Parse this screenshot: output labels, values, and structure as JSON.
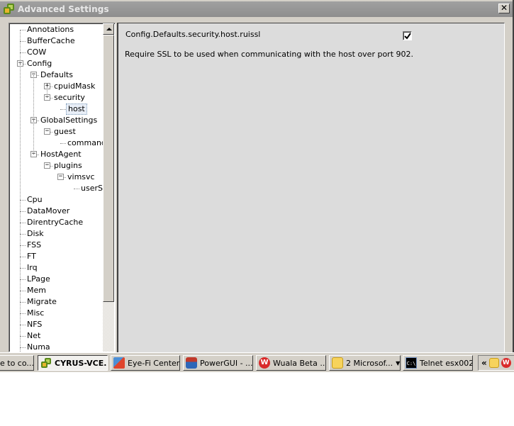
{
  "window": {
    "title": "Advanced Settings",
    "close_label": "✕"
  },
  "tree": {
    "items": [
      {
        "label": "Annotations",
        "depth": 0,
        "expander": null
      },
      {
        "label": "BufferCache",
        "depth": 0,
        "expander": null
      },
      {
        "label": "COW",
        "depth": 0,
        "expander": null
      },
      {
        "label": "Config",
        "depth": 0,
        "expander": "collapse"
      },
      {
        "label": "Defaults",
        "depth": 1,
        "expander": "collapse"
      },
      {
        "label": "cpuidMask",
        "depth": 2,
        "expander": "expand"
      },
      {
        "label": "security",
        "depth": 2,
        "expander": "collapse"
      },
      {
        "label": "host",
        "depth": 3,
        "expander": null,
        "selected": true
      },
      {
        "label": "GlobalSettings",
        "depth": 1,
        "expander": "collapse"
      },
      {
        "label": "guest",
        "depth": 2,
        "expander": "collapse"
      },
      {
        "label": "commands",
        "depth": 3,
        "expander": null
      },
      {
        "label": "HostAgent",
        "depth": 1,
        "expander": "collapse"
      },
      {
        "label": "plugins",
        "depth": 2,
        "expander": "collapse"
      },
      {
        "label": "vimsvc",
        "depth": 3,
        "expander": "collapse"
      },
      {
        "label": "userSe",
        "depth": 4,
        "expander": null
      },
      {
        "label": "Cpu",
        "depth": 0,
        "expander": null
      },
      {
        "label": "DataMover",
        "depth": 0,
        "expander": null
      },
      {
        "label": "DirentryCache",
        "depth": 0,
        "expander": null
      },
      {
        "label": "Disk",
        "depth": 0,
        "expander": null
      },
      {
        "label": "FSS",
        "depth": 0,
        "expander": null
      },
      {
        "label": "FT",
        "depth": 0,
        "expander": null
      },
      {
        "label": "Irq",
        "depth": 0,
        "expander": null
      },
      {
        "label": "LPage",
        "depth": 0,
        "expander": null
      },
      {
        "label": "Mem",
        "depth": 0,
        "expander": null
      },
      {
        "label": "Migrate",
        "depth": 0,
        "expander": null
      },
      {
        "label": "Misc",
        "depth": 0,
        "expander": null
      },
      {
        "label": "NFS",
        "depth": 0,
        "expander": null
      },
      {
        "label": "Net",
        "depth": 0,
        "expander": null
      },
      {
        "label": "Numa",
        "depth": 0,
        "expander": null
      }
    ]
  },
  "detail": {
    "setting_name": "Config.Defaults.security.host.ruissl",
    "setting_checked": true,
    "setting_description": "Require SSL to be used when communicating with the host over port 902."
  },
  "taskbar": {
    "tasks": [
      {
        "label": "e to co...",
        "icon": "none",
        "active": false
      },
      {
        "label": "CYRUS-VCE...",
        "icon": "vmware-icon",
        "active": true
      },
      {
        "label": "Eye-Fi Center",
        "icon": "eyefi-icon",
        "active": false
      },
      {
        "label": "PowerGUI - ...",
        "icon": "powergui-icon",
        "active": false
      },
      {
        "label": "Wuala Beta ...",
        "icon": "wuala-icon",
        "active": false
      },
      {
        "label": "2 Microsof...",
        "icon": "outlook-icon",
        "active": false,
        "group": true
      },
      {
        "label": "Telnet esx002",
        "icon": "cmd-icon",
        "active": false
      }
    ],
    "tray_chevron": "«",
    "wuala_glyph": "W",
    "cmd_glyph": "C:\\"
  }
}
